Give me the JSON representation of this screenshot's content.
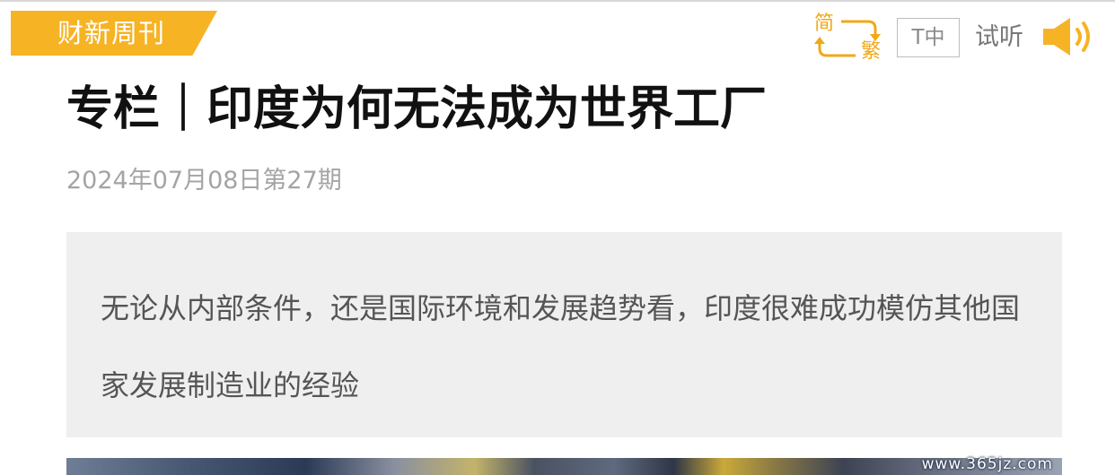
{
  "header": {
    "brand": "财新周刊",
    "convert": {
      "simplified": "简",
      "traditional": "繁"
    },
    "font_size_label": "T中",
    "listen_label": "试听",
    "accent_color": "#f6b324",
    "icons": [
      "convert-icon",
      "speaker-icon"
    ]
  },
  "article": {
    "title": "专栏｜印度为何无法成为世界工厂",
    "issue_date": "2024年07月08日第27期",
    "summary": "无论从内部条件，还是国际环境和发展趋势看，印度很难成功模仿其他国家发展制造业的经验"
  },
  "watermark": "www.365jz.com"
}
